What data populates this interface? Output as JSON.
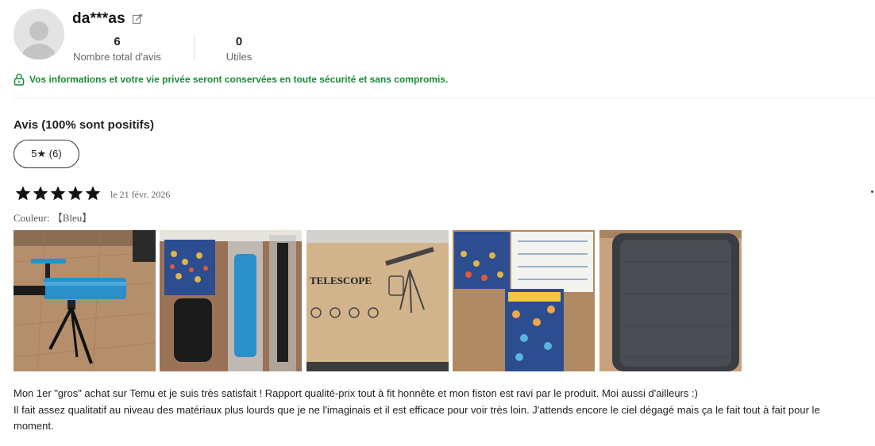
{
  "profile": {
    "username": "da***as",
    "total_reviews_value": "6",
    "total_reviews_label": "Nombre total d'avis",
    "helpful_value": "0",
    "helpful_label": "Utiles"
  },
  "privacy_notice": "Vos informations et votre vie privée seront conservées en toute sécurité et sans compromis.",
  "reviews_section": {
    "title": "Avis (100% sont positifs)",
    "filter_chip": "5★ (6)"
  },
  "review": {
    "rating": 5,
    "date": "le 21 févr. 2026",
    "color_label": "Couleur:  【Bleu】",
    "photos": [
      "telescope-on-tripod",
      "unboxed-contents",
      "telescope-box",
      "sticker-sheets-and-manual",
      "carry-bag"
    ],
    "text": "Mon 1er \"gros\" achat sur Temu et je suis très satisfait ! Rapport qualité-prix tout à fit honnête et mon fiston est ravi par le produit. Moi aussi d'ailleurs :)\nIl fait assez qualitatif au niveau des matériaux plus lourds que je ne l'imaginais et il est efficace pour voir très loin. J'attends encore le ciel dégagé mais ça le fait tout à fait pour le\nmoment."
  },
  "colors": {
    "privacy_green": "#1a8a3b",
    "star": "#111111",
    "telescope_blue": "#2b8fc9"
  }
}
